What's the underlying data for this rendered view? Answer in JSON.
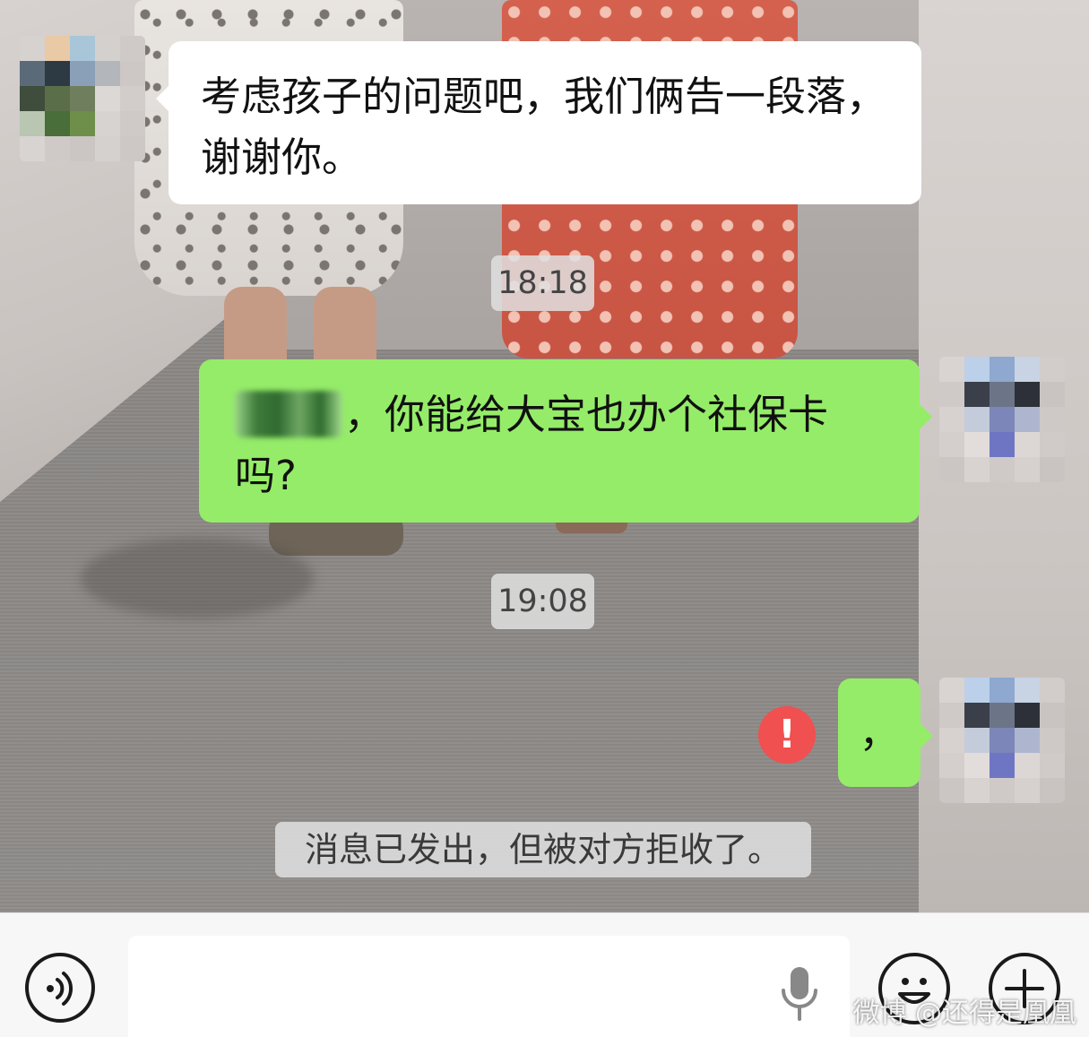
{
  "messages": {
    "incoming_1": "考虑孩子的问题吧，我们俩告一段落，谢谢你。",
    "time_1": "18:18",
    "outgoing_1_suffix": "，你能给大宝也办个社保卡吗?",
    "time_2": "19:08",
    "outgoing_2": "，",
    "system_notice": "消息已发出，但被对方拒收了。"
  },
  "status": {
    "error_badge": "!",
    "error_color": "#f05050"
  },
  "colors": {
    "incoming_bubble": "#ffffff",
    "outgoing_bubble": "#95ec69"
  },
  "input_bar": {
    "value": "",
    "voice_icon": "voice-icon",
    "mic_icon": "microphone-icon",
    "emoji_icon": "emoji-icon",
    "plus_icon": "plus-icon"
  },
  "watermark": "微博 @还得是凰凰"
}
